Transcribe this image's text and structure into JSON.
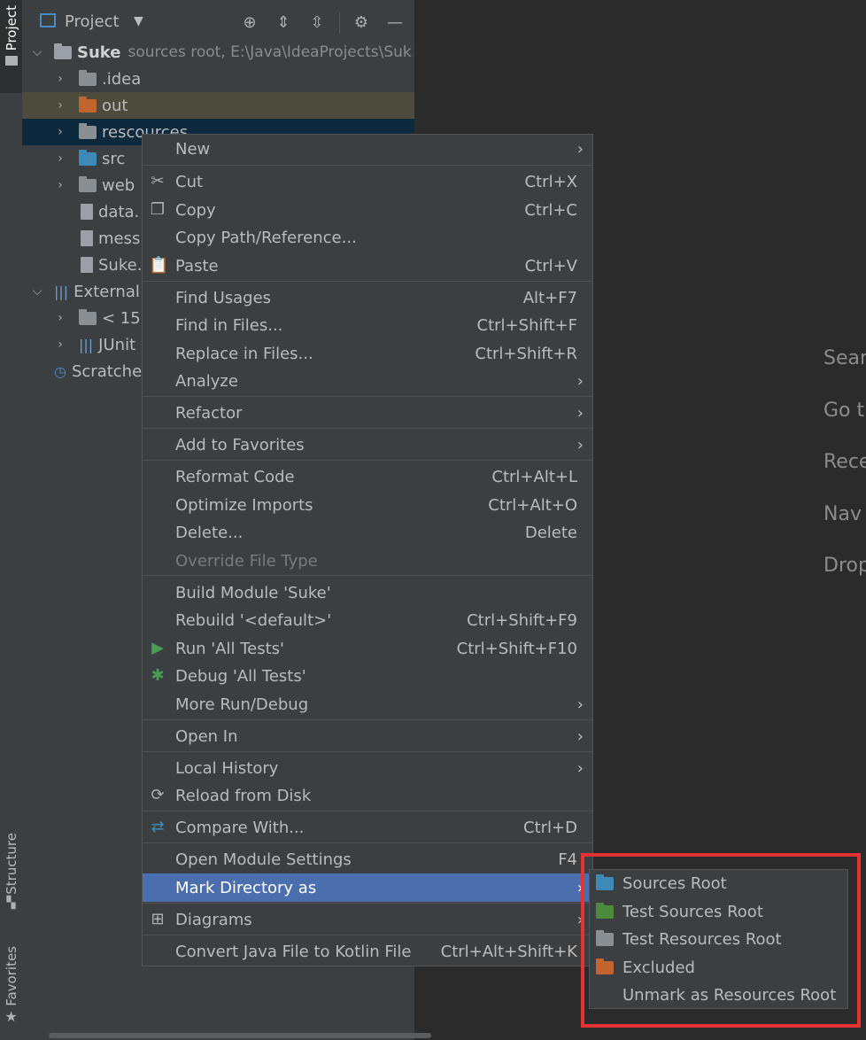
{
  "sidebar": {
    "project_tab": "Project",
    "structure_tab": "Structure",
    "favorites_tab": "Favorites"
  },
  "panel": {
    "title": "Project",
    "tree": [
      {
        "label": "Suke",
        "hint": "sources root,  E:\\Java\\IdeaProjects\\Suk",
        "expanded": true
      },
      {
        "label": ".idea"
      },
      {
        "label": "out"
      },
      {
        "label": "rescources"
      },
      {
        "label": "src"
      },
      {
        "label": "web"
      },
      {
        "label": "data."
      },
      {
        "label": "mess"
      },
      {
        "label": "Suke."
      },
      {
        "label": "External"
      },
      {
        "label": "< 15"
      },
      {
        "label": "JUnit"
      },
      {
        "label": "Scratche"
      }
    ]
  },
  "editor_hints": [
    "Sear",
    "Go t",
    "Rece",
    "Nav",
    "Drop"
  ],
  "menu": {
    "items": [
      {
        "label": "New"
      },
      {
        "label": "Cut",
        "shortcut": "Ctrl+X"
      },
      {
        "label": "Copy",
        "shortcut": "Ctrl+C"
      },
      {
        "label": "Copy Path/Reference..."
      },
      {
        "label": "Paste",
        "shortcut": "Ctrl+V"
      },
      {
        "label": "Find Usages",
        "shortcut": "Alt+F7"
      },
      {
        "label": "Find in Files...",
        "shortcut": "Ctrl+Shift+F"
      },
      {
        "label": "Replace in Files...",
        "shortcut": "Ctrl+Shift+R"
      },
      {
        "label": "Analyze"
      },
      {
        "label": "Refactor"
      },
      {
        "label": "Add to Favorites"
      },
      {
        "label": "Reformat Code",
        "shortcut": "Ctrl+Alt+L"
      },
      {
        "label": "Optimize Imports",
        "shortcut": "Ctrl+Alt+O"
      },
      {
        "label": "Delete...",
        "shortcut": "Delete"
      },
      {
        "label": "Override File Type"
      },
      {
        "label": "Build Module 'Suke'"
      },
      {
        "label": "Rebuild '<default>'",
        "shortcut": "Ctrl+Shift+F9"
      },
      {
        "label": "Run 'All Tests'",
        "shortcut": "Ctrl+Shift+F10"
      },
      {
        "label": "Debug 'All Tests'"
      },
      {
        "label": "More Run/Debug"
      },
      {
        "label": "Open In"
      },
      {
        "label": "Local History"
      },
      {
        "label": "Reload from Disk"
      },
      {
        "label": "Compare With...",
        "shortcut": "Ctrl+D"
      },
      {
        "label": "Open Module Settings",
        "shortcut": "F4"
      },
      {
        "label": "Mark Directory as"
      },
      {
        "label": "Diagrams"
      },
      {
        "label": "Convert Java File to Kotlin File",
        "shortcut": "Ctrl+Alt+Shift+K"
      }
    ]
  },
  "submenu": {
    "items": [
      {
        "label": "Sources Root",
        "color": "#3d8ab8"
      },
      {
        "label": "Test Sources Root",
        "color": "#4c8b3a"
      },
      {
        "label": "Test Resources Root",
        "color": "#8a8f94"
      },
      {
        "label": "Excluded",
        "color": "#c3632e"
      },
      {
        "label": "Unmark as Resources Root"
      }
    ]
  },
  "colors": {
    "selection": "#4b6eaf",
    "highlight_box": "#e53333",
    "out_row_bg": "#4d4b3d",
    "selected_row_bg": "#0d293e"
  }
}
